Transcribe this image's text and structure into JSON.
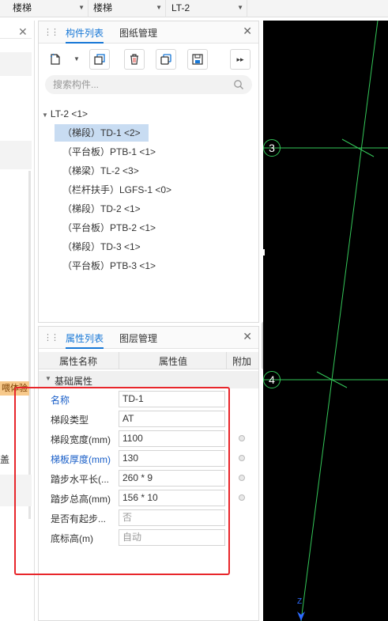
{
  "topbar": {
    "floor_type_1": "楼梯",
    "floor_type_2": "楼梯",
    "component": "LT-2"
  },
  "left_panel": {
    "tag_label": "喂体验",
    "side_text": "盖"
  },
  "component_panel": {
    "tabs": [
      "构件列表",
      "图纸管理"
    ],
    "active_tab": 0,
    "search_placeholder": "搜索构件...",
    "tree": {
      "root": "LT-2 <1>",
      "items": [
        {
          "label": "（梯段）TD-1 <2>",
          "selected": true
        },
        {
          "label": "（平台板）PTB-1 <1>",
          "selected": false
        },
        {
          "label": "（梯梁）TL-2 <3>",
          "selected": false
        },
        {
          "label": "（栏杆扶手）LGFS-1 <0>",
          "selected": false
        },
        {
          "label": "（梯段）TD-2 <1>",
          "selected": false
        },
        {
          "label": "（平台板）PTB-2 <1>",
          "selected": false
        },
        {
          "label": "（梯段）TD-3 <1>",
          "selected": false
        },
        {
          "label": "（平台板）PTB-3 <1>",
          "selected": false
        }
      ]
    }
  },
  "property_panel": {
    "tabs": [
      "属性列表",
      "图层管理"
    ],
    "active_tab": 0,
    "columns": [
      "属性名称",
      "属性值",
      "附加"
    ],
    "group": "基础属性",
    "rows": [
      {
        "name": "名称",
        "value": "TD-1",
        "blue": true,
        "muted": false,
        "extra": false
      },
      {
        "name": "梯段类型",
        "value": "AT",
        "blue": false,
        "muted": false,
        "extra": false
      },
      {
        "name": "梯段宽度(mm)",
        "value": "1100",
        "blue": false,
        "muted": false,
        "extra": true
      },
      {
        "name": "梯板厚度(mm)",
        "value": "130",
        "blue": true,
        "muted": false,
        "extra": true
      },
      {
        "name": "踏步水平长(...",
        "value": "260 * 9",
        "blue": false,
        "muted": false,
        "extra": true
      },
      {
        "name": "踏步总高(mm)",
        "value": "156 * 10",
        "blue": false,
        "muted": false,
        "extra": true
      },
      {
        "name": "是否有起步...",
        "value": "否",
        "blue": false,
        "muted": true,
        "extra": false
      },
      {
        "name": "底标高(m)",
        "value": "自动",
        "blue": false,
        "muted": true,
        "extra": false
      }
    ]
  },
  "canvas": {
    "axis_labels": [
      "3",
      "4"
    ],
    "bottom_marker": "Z"
  },
  "colors": {
    "accent": "#1677d6",
    "highlight_box": "#e8262b",
    "grid_line": "#34c759",
    "canvas_bg": "#000000"
  }
}
